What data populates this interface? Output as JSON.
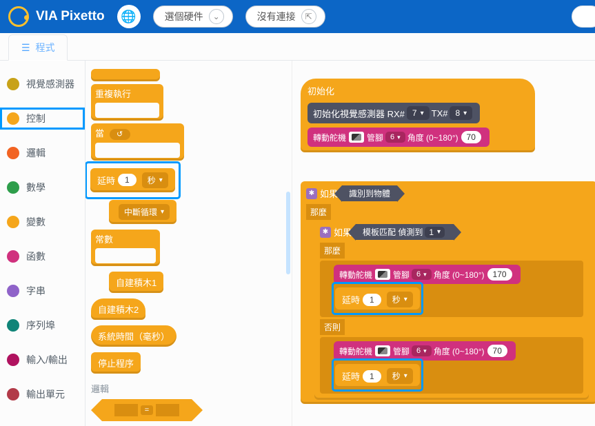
{
  "header": {
    "brand": "VIA Pixetto",
    "select_hw": "選個硬件",
    "no_conn": "沒有連接"
  },
  "tabs": {
    "code": "程式"
  },
  "sidebar": {
    "items": [
      {
        "label": "視覺感測器",
        "color": "#c8a218"
      },
      {
        "label": "控制",
        "color": "#f5a61b"
      },
      {
        "label": "邏輯",
        "color": "#f26322"
      },
      {
        "label": "數學",
        "color": "#2e9e4b"
      },
      {
        "label": "變數",
        "color": "#f5a61b"
      },
      {
        "label": "函數",
        "color": "#d0317e"
      },
      {
        "label": "字串",
        "color": "#8f63c9"
      },
      {
        "label": "序列埠",
        "color": "#108478"
      },
      {
        "label": "輸入/輸出",
        "color": "#b0125f"
      },
      {
        "label": "輸出單元",
        "color": "#b23a48"
      }
    ]
  },
  "palette": {
    "repeat": "重複執行",
    "when": "當",
    "delay": "延時",
    "delay_val": "1",
    "delay_unit": "秒",
    "break_loop": "中斷循環",
    "constant": "常數",
    "custom1": "自建積木1",
    "custom2": "自建積木2",
    "systime": "系統時間（毫秒）",
    "stop": "停止程序",
    "grp_logic": "邏輯",
    "eq_op": "="
  },
  "ws": {
    "init": "初始化",
    "init_sensor": "初始化視覺感測器 RX#",
    "rx": "7",
    "tx_lbl": "TX#",
    "tx": "8",
    "servo": "轉動舵機",
    "pin": "管腳",
    "pin_v": "6",
    "angle": "角度 (0~180°)",
    "ang_init": "70",
    "if": "如果",
    "then": "那麼",
    "else": "否則",
    "detected": "識別到物體",
    "tpl": "模板匹配 偵測到",
    "tpl_v": "1",
    "ang_true": "170",
    "ang_false": "70",
    "delay": "延時",
    "delay_v": "1",
    "delay_u": "秒"
  }
}
